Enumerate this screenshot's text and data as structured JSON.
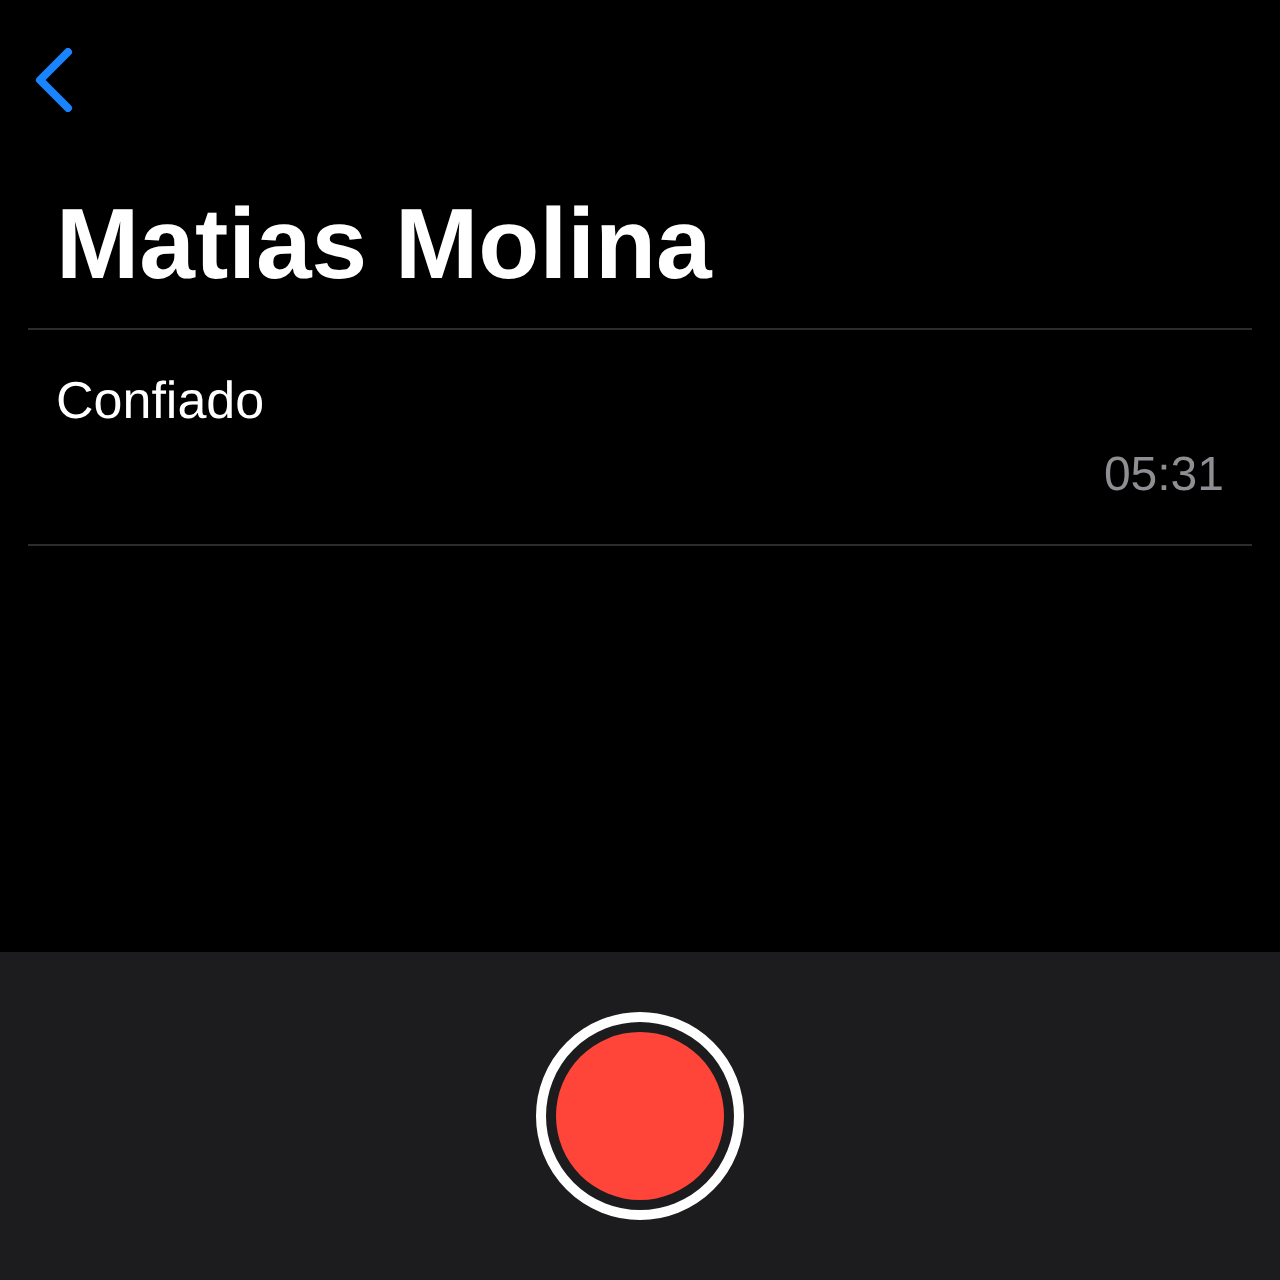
{
  "title": "Matias Molina",
  "recordings": [
    {
      "name": "Confiado",
      "duration": "05:31"
    }
  ]
}
